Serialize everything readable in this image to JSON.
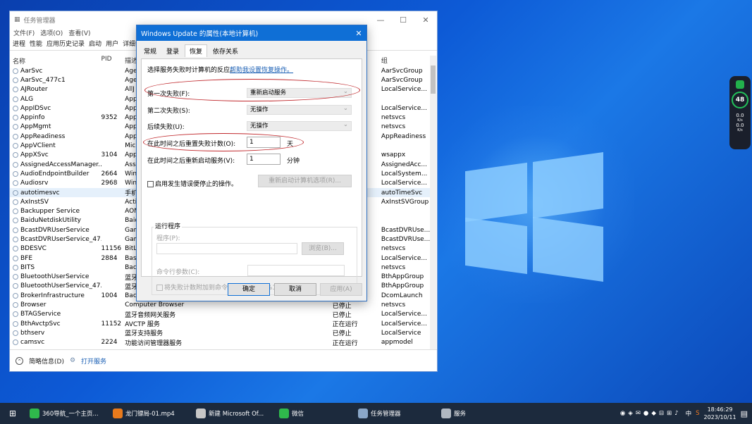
{
  "taskmgr": {
    "title": "任务管理器",
    "menu": [
      "文件(F)",
      "选项(O)",
      "查看(V)"
    ],
    "tabs": [
      "进程",
      "性能",
      "应用历史记录",
      "启动",
      "用户",
      "详细信"
    ],
    "columns": {
      "name": "名称",
      "pid": "PID",
      "desc": "描述",
      "group": "组"
    },
    "rows": [
      {
        "name": "AarSvc",
        "pid": "",
        "desc": "Age",
        "status": "",
        "group": "AarSvcGroup"
      },
      {
        "name": "AarSvc_477c1",
        "pid": "",
        "desc": "Age",
        "status": "",
        "group": "AarSvcGroup"
      },
      {
        "name": "AJRouter",
        "pid": "",
        "desc": "AllJ",
        "status": "",
        "group": "LocalServicе..."
      },
      {
        "name": "ALG",
        "pid": "",
        "desc": "App",
        "status": "",
        "group": ""
      },
      {
        "name": "AppIDSvc",
        "pid": "",
        "desc": "App",
        "status": "",
        "group": "LocalServicе..."
      },
      {
        "name": "Appinfo",
        "pid": "9352",
        "desc": "App",
        "status": "",
        "group": "netsvcs"
      },
      {
        "name": "AppMgmt",
        "pid": "",
        "desc": "App",
        "status": "",
        "group": "netsvcs"
      },
      {
        "name": "AppReadiness",
        "pid": "",
        "desc": "App",
        "status": "",
        "group": "AppReadiness"
      },
      {
        "name": "AppVClient",
        "pid": "",
        "desc": "Mic",
        "status": "",
        "group": ""
      },
      {
        "name": "AppXSvc",
        "pid": "3104",
        "desc": "App",
        "status": "",
        "group": "wsappx"
      },
      {
        "name": "AssignedAccessManager...",
        "pid": "",
        "desc": "Assi",
        "status": "",
        "group": "AssignedAcc..."
      },
      {
        "name": "AudioEndpointBuilder",
        "pid": "2664",
        "desc": "Win",
        "status": "",
        "group": "LocalSystem..."
      },
      {
        "name": "Audiosrv",
        "pid": "2968",
        "desc": "Win",
        "status": "",
        "group": "LocalServicе..."
      },
      {
        "name": "autotimesvc",
        "pid": "",
        "desc": "手机",
        "status": "",
        "group": "autoTimeSvc",
        "sel": true
      },
      {
        "name": "AxInstSV",
        "pid": "",
        "desc": "Acti",
        "status": "",
        "group": "AxInstSVGroup"
      },
      {
        "name": "Backupper Service",
        "pid": "",
        "desc": "AOM",
        "status": "",
        "group": ""
      },
      {
        "name": "BaiduNetdiskUtility",
        "pid": "",
        "desc": "Baid",
        "status": "",
        "group": ""
      },
      {
        "name": "BcastDVRUserService",
        "pid": "",
        "desc": "Gam",
        "status": "",
        "group": "BcastDVRUse..."
      },
      {
        "name": "BcastDVRUserService_47...",
        "pid": "",
        "desc": "Gam",
        "status": "",
        "group": "BcastDVRUse..."
      },
      {
        "name": "BDESVC",
        "pid": "11156",
        "desc": "BitL",
        "status": "",
        "group": "netsvcs"
      },
      {
        "name": "BFE",
        "pid": "2884",
        "desc": "Base",
        "status": "",
        "group": "LocalServicе..."
      },
      {
        "name": "BITS",
        "pid": "",
        "desc": "Bacl",
        "status": "",
        "group": "netsvcs"
      },
      {
        "name": "BluetoothUserService",
        "pid": "",
        "desc": "蓝牙",
        "status": "",
        "group": "BthAppGroup"
      },
      {
        "name": "BluetoothUserService_47...",
        "pid": "",
        "desc": "蓝牙",
        "status": "",
        "group": "BthAppGroup"
      },
      {
        "name": "BrokerInfrastructure",
        "pid": "1004",
        "desc": "Bacl",
        "status": "",
        "group": "DcomLaunch"
      },
      {
        "name": "Browser",
        "pid": "",
        "desc": "Computer Browser",
        "status": "已停止",
        "group": "netsvcs"
      },
      {
        "name": "BTAGService",
        "pid": "",
        "desc": "蓝牙音频网关服务",
        "status": "已停止",
        "group": "LocalServicе..."
      },
      {
        "name": "BthAvctpSvc",
        "pid": "11152",
        "desc": "AVCTP 服务",
        "status": "正在运行",
        "group": "LocalServicе..."
      },
      {
        "name": "bthserv",
        "pid": "",
        "desc": "蓝牙支持服务",
        "status": "已停止",
        "group": "LocalServicе"
      },
      {
        "name": "camsvc",
        "pid": "2224",
        "desc": "功能访问管理器服务",
        "status": "正在运行",
        "group": "appmodel"
      }
    ],
    "footer": {
      "summary": "简略信息(D)",
      "open_services": "打开服务"
    }
  },
  "dialog": {
    "title": "Windows Update 的属性(本地计算机)",
    "tabs": [
      "常规",
      "登录",
      "恢复",
      "依存关系"
    ],
    "intro": "选择服务失败时计算机的反应。",
    "help_link": "帮助我设置恢复操作。",
    "first_failure_label": "第一次失败(F):",
    "first_failure_value": "重新启动服务",
    "second_failure_label": "第二次失败(S):",
    "second_failure_value": "无操作",
    "subsequent_label": "后续失败(U):",
    "subsequent_value": "无操作",
    "reset_label": "在此时间之后重置失败计数(O):",
    "reset_value": "1",
    "reset_unit": "天",
    "restart_label": "在此时间之后重新启动服务(V):",
    "restart_value": "1",
    "restart_unit": "分钟",
    "enable_actions": "启用发生错误便停止的操作。",
    "restart_options_btn": "重新启动计算机选项(R)...",
    "run_group": "运行程序",
    "program_label": "程序(P):",
    "browse_btn": "浏览(B)...",
    "cmd_label": "命令行参数(C):",
    "append_fail": "将失败计数附加到命令行结尾(/fail=%1%)(E)",
    "ok": "确定",
    "cancel": "取消",
    "apply": "应用(A)"
  },
  "widget": {
    "percent": "48",
    "net1": "0.0",
    "net1_unit": "K/s",
    "net2": "0.0",
    "net2_unit": "K/s"
  },
  "taskbar": {
    "items": [
      {
        "label": "360导航_一个主页...",
        "color": "#2fb94c"
      },
      {
        "label": "龙门镖局-01.mp4",
        "color": "#e87a1c"
      },
      {
        "label": "新建 Microsoft Of...",
        "color": "#c8c8c8"
      },
      {
        "label": "微信",
        "color": "#2fb94c"
      },
      {
        "label": "任务管理器",
        "color": "#8aa7c9"
      },
      {
        "label": "服务",
        "color": "#b0b8c2"
      }
    ],
    "ime": "中",
    "time": "18:46:29",
    "date": "2023/10/11"
  }
}
